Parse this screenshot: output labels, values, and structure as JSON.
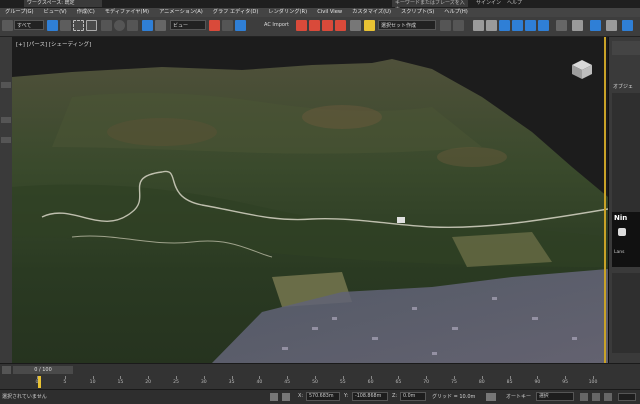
{
  "titlebar": {
    "document_tab": "ワークスペース: 既定",
    "search_placeholder": "キーワードまたはフレーズを入力",
    "right_items": [
      "サインイン",
      "ヘルプ"
    ]
  },
  "menubar": {
    "items": [
      "グループ(G)",
      "ビュー(V)",
      "作成(C)",
      "モディファイヤ(M)",
      "アニメーション(A)",
      "グラフ エディタ(D)",
      "レンダリング(R)",
      "Civil View",
      "カスタマイズ(U)",
      "スクリプト(S)",
      "ヘルプ(H)"
    ]
  },
  "toolbar": {
    "selection_filter": "すべて",
    "coord_system": "ビュー",
    "ac_import_label": "AC Import",
    "named_selection": "選択セット作成",
    "colors": {
      "blue": "#2f7fd6",
      "red": "#d94a3a",
      "yellow": "#e8c233",
      "gray": "#9a9a9a"
    }
  },
  "viewport": {
    "label": "[+] [パース] [シェーディング]"
  },
  "rightpanel": {
    "top_label": "オブジェ",
    "mid_label": "Nin",
    "bottom_label": "Lans"
  },
  "timeline": {
    "frame_readout": "0 / 100",
    "ticks": [
      "0",
      "5",
      "10",
      "15",
      "20",
      "25",
      "30",
      "35",
      "40",
      "45",
      "50",
      "55",
      "60",
      "65",
      "70",
      "75",
      "80",
      "85",
      "90",
      "95",
      "100"
    ]
  },
  "statusbar": {
    "prompt": "選択されていません",
    "x_label": "X:",
    "x_value": "570.683m",
    "y_label": "Y:",
    "y_value": "-108.868m",
    "z_label": "Z:",
    "z_value": "0.0m",
    "grid_label": "グリッド = 10.0m",
    "autokey_label": "オートキー",
    "selected_label": "選択"
  }
}
